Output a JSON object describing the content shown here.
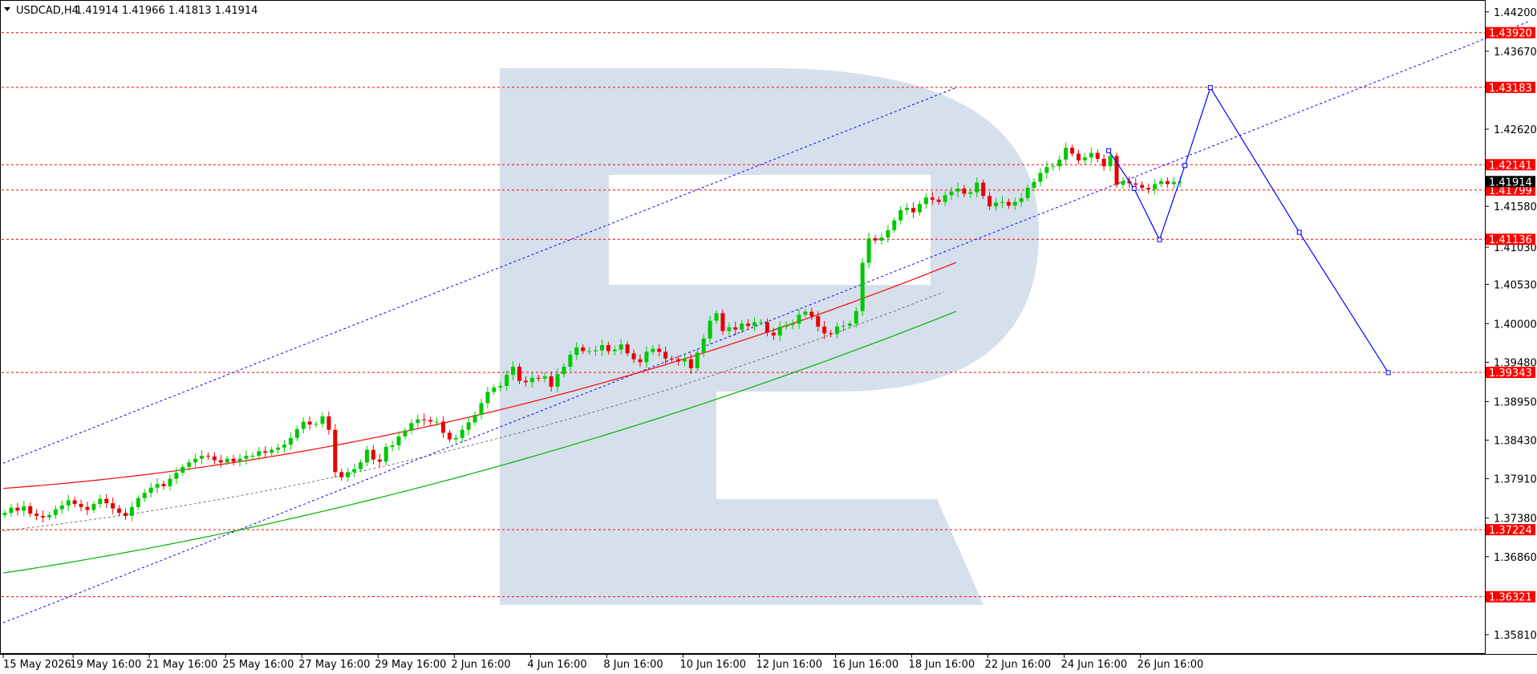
{
  "header": {
    "symbol": "USDCAD,H4",
    "ohlc": "1.41914 1.41966 1.41813 1.41914"
  },
  "colors": {
    "bull": "#00c800",
    "bear": "#e60000",
    "resistance_line": "#ff0000",
    "trend_channel": "#0000ff",
    "forecast": "#0000ff",
    "upper_ma": "#ff0000",
    "lower_ma": "#00b400",
    "mid_ma": "#555555",
    "watermark": "#d6e0ec",
    "level_label_bg": "#ff0000",
    "current_label_bg": "#000000"
  },
  "chart_data": {
    "type": "candlestick",
    "symbol": "USDCAD",
    "timeframe": "H4",
    "y_range": [
      1.3555,
      1.4436
    ],
    "x_range_bars": [
      0,
      240
    ],
    "y_ticks": [
      "1.44200",
      "1.43670",
      "1.42620",
      "1.41580",
      "1.41030",
      "1.40530",
      "1.40000",
      "1.39480",
      "1.38950",
      "1.38430",
      "1.37910",
      "1.37380",
      "1.36860",
      "1.35810"
    ],
    "x_labels": [
      {
        "label": "15 May 2026",
        "bar": 0
      },
      {
        "label": "19 May 16:00",
        "bar": 11
      },
      {
        "label": "21 May 16:00",
        "bar": 23
      },
      {
        "label": "25 May 16:00",
        "bar": 35
      },
      {
        "label": "27 May 16:00",
        "bar": 47
      },
      {
        "label": "29 May 16:00",
        "bar": 59
      },
      {
        "label": "2 Jun 16:00",
        "bar": 71
      },
      {
        "label": "4 Jun 16:00",
        "bar": 83
      },
      {
        "label": "8 Jun 16:00",
        "bar": 95
      },
      {
        "label": "10 Jun 16:00",
        "bar": 107
      },
      {
        "label": "12 Jun 16:00",
        "bar": 119
      },
      {
        "label": "16 Jun 16:00",
        "bar": 131
      },
      {
        "label": "18 Jun 16:00",
        "bar": 143
      },
      {
        "label": "22 Jun 16:00",
        "bar": 155
      },
      {
        "label": "24 Jun 16:00",
        "bar": 167
      },
      {
        "label": "26 Jun 16:00",
        "bar": 179
      }
    ],
    "horizontal_levels": [
      "1.43920",
      "1.43183",
      "1.42141",
      "1.41799",
      "1.41136",
      "1.39343",
      "1.37224",
      "1.36321"
    ],
    "current_price": "1.41914",
    "candles_close": [
      1.3745,
      1.3752,
      1.3748,
      1.3754,
      1.3744,
      1.3741,
      1.3739,
      1.3742,
      1.375,
      1.3755,
      1.3762,
      1.3757,
      1.3753,
      1.3749,
      1.3757,
      1.3764,
      1.3758,
      1.3751,
      1.3745,
      1.3741,
      1.3753,
      1.3765,
      1.3772,
      1.3779,
      1.3784,
      1.3781,
      1.3791,
      1.3799,
      1.3807,
      1.3813,
      1.3818,
      1.3822,
      1.3821,
      1.3816,
      1.3813,
      1.3818,
      1.3814,
      1.3818,
      1.3822,
      1.3822,
      1.3828,
      1.3826,
      1.383,
      1.3833,
      1.3837,
      1.3846,
      1.3858,
      1.3868,
      1.3864,
      1.3865,
      1.3875,
      1.3857,
      1.38,
      1.3793,
      1.38,
      1.3804,
      1.3813,
      1.383,
      1.3817,
      1.3814,
      1.3834,
      1.3836,
      1.3848,
      1.3856,
      1.3866,
      1.3871,
      1.387,
      1.3868,
      1.3868,
      1.3853,
      1.3844,
      1.3846,
      1.3857,
      1.3867,
      1.3877,
      1.3893,
      1.3908,
      1.3914,
      1.3916,
      1.3931,
      1.3942,
      1.3923,
      1.3921,
      1.3927,
      1.3926,
      1.3929,
      1.3915,
      1.3932,
      1.3942,
      1.3958,
      1.3968,
      1.3963,
      1.3963,
      1.3964,
      1.3971,
      1.3963,
      1.3965,
      1.3972,
      1.396,
      1.3952,
      1.3948,
      1.3962,
      1.3966,
      1.3962,
      1.3953,
      1.3952,
      1.3949,
      1.3952,
      1.394,
      1.3961,
      1.398,
      1.4004,
      1.4014,
      1.399,
      1.3995,
      1.3992,
      1.4,
      1.3997,
      1.4002,
      1.4002,
      1.3988,
      1.3984,
      1.3996,
      1.3998,
      1.4,
      1.4012,
      1.4016,
      1.401,
      1.3996,
      1.3987,
      1.3986,
      1.3996,
      1.3997,
      1.4,
      1.4017,
      1.4082,
      1.4115,
      1.4112,
      1.4116,
      1.4126,
      1.4139,
      1.4153,
      1.4156,
      1.415,
      1.4161,
      1.417,
      1.4167,
      1.4164,
      1.4173,
      1.4178,
      1.4182,
      1.4175,
      1.4177,
      1.419,
      1.4172,
      1.4158,
      1.4163,
      1.4164,
      1.4159,
      1.4164,
      1.4169,
      1.4183,
      1.4191,
      1.4203,
      1.4211,
      1.4212,
      1.4221,
      1.4237,
      1.4229,
      1.422,
      1.4224,
      1.423,
      1.4222,
      1.4212,
      1.4226,
      1.4187,
      1.4192,
      1.4189,
      1.4187,
      1.4183,
      1.4181,
      1.4188,
      1.4192,
      1.4188,
      1.4191,
      1.4191
    ]
  },
  "forecast_path": [
    {
      "bar": 174,
      "price": 1.4233
    },
    {
      "bar": 178,
      "price": 1.4182
    },
    {
      "bar": 182,
      "price": 1.4113
    },
    {
      "bar": 186,
      "price": 1.4213
    },
    {
      "bar": 190,
      "price": 1.4318
    },
    {
      "bar": 204,
      "price": 1.4123
    },
    {
      "bar": 218,
      "price": 1.3934
    }
  ]
}
